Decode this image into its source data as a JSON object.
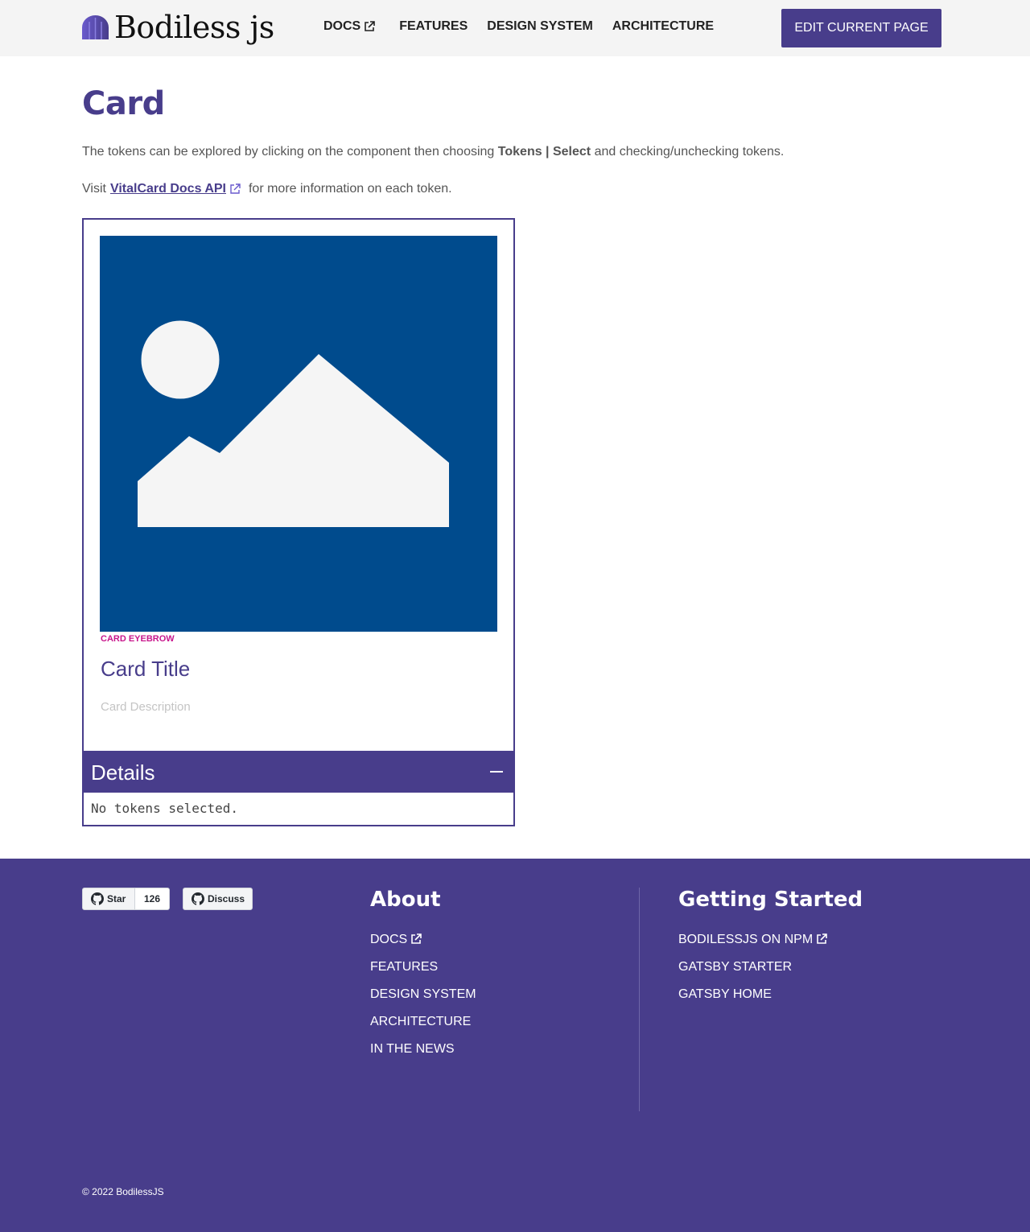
{
  "header": {
    "logo_text": "Bodiless js",
    "nav": [
      {
        "label": "DOCS",
        "external": true
      },
      {
        "label": "FEATURES"
      },
      {
        "label": "DESIGN SYSTEM"
      },
      {
        "label": "ARCHITECTURE"
      }
    ],
    "edit_button": "EDIT CURRENT PAGE"
  },
  "main": {
    "title": "Card",
    "intro_before": "The tokens can be explored by clicking on the component then choosing ",
    "intro_bold": "Tokens | Select",
    "intro_after": " and checking/unchecking tokens.",
    "visit_before": "Visit",
    "visit_link": "VitalCard Docs API",
    "visit_after": "for more information on each token.",
    "card": {
      "eyebrow": "CARD EYEBROW",
      "title": "Card Title",
      "description": "Card Description",
      "image_icon": "image-placeholder-icon"
    },
    "details": {
      "label": "Details",
      "content": "No tokens selected."
    }
  },
  "footer": {
    "github_star": "Star",
    "github_star_count": "126",
    "github_discuss": "Discuss",
    "about": {
      "title": "About",
      "links": [
        "DOCS",
        "FEATURES",
        "DESIGN SYSTEM",
        "ARCHITECTURE",
        "IN THE NEWS"
      ]
    },
    "getting_started": {
      "title": "Getting Started",
      "links": [
        "BODILESSJS ON NPM",
        "GATSBY STARTER",
        "GATSBY HOME"
      ]
    },
    "copyright": "©  2022 BodilessJS"
  },
  "colors": {
    "brand": "#483d8b",
    "image_bg": "#004b8d",
    "eyebrow": "#c8168c"
  }
}
